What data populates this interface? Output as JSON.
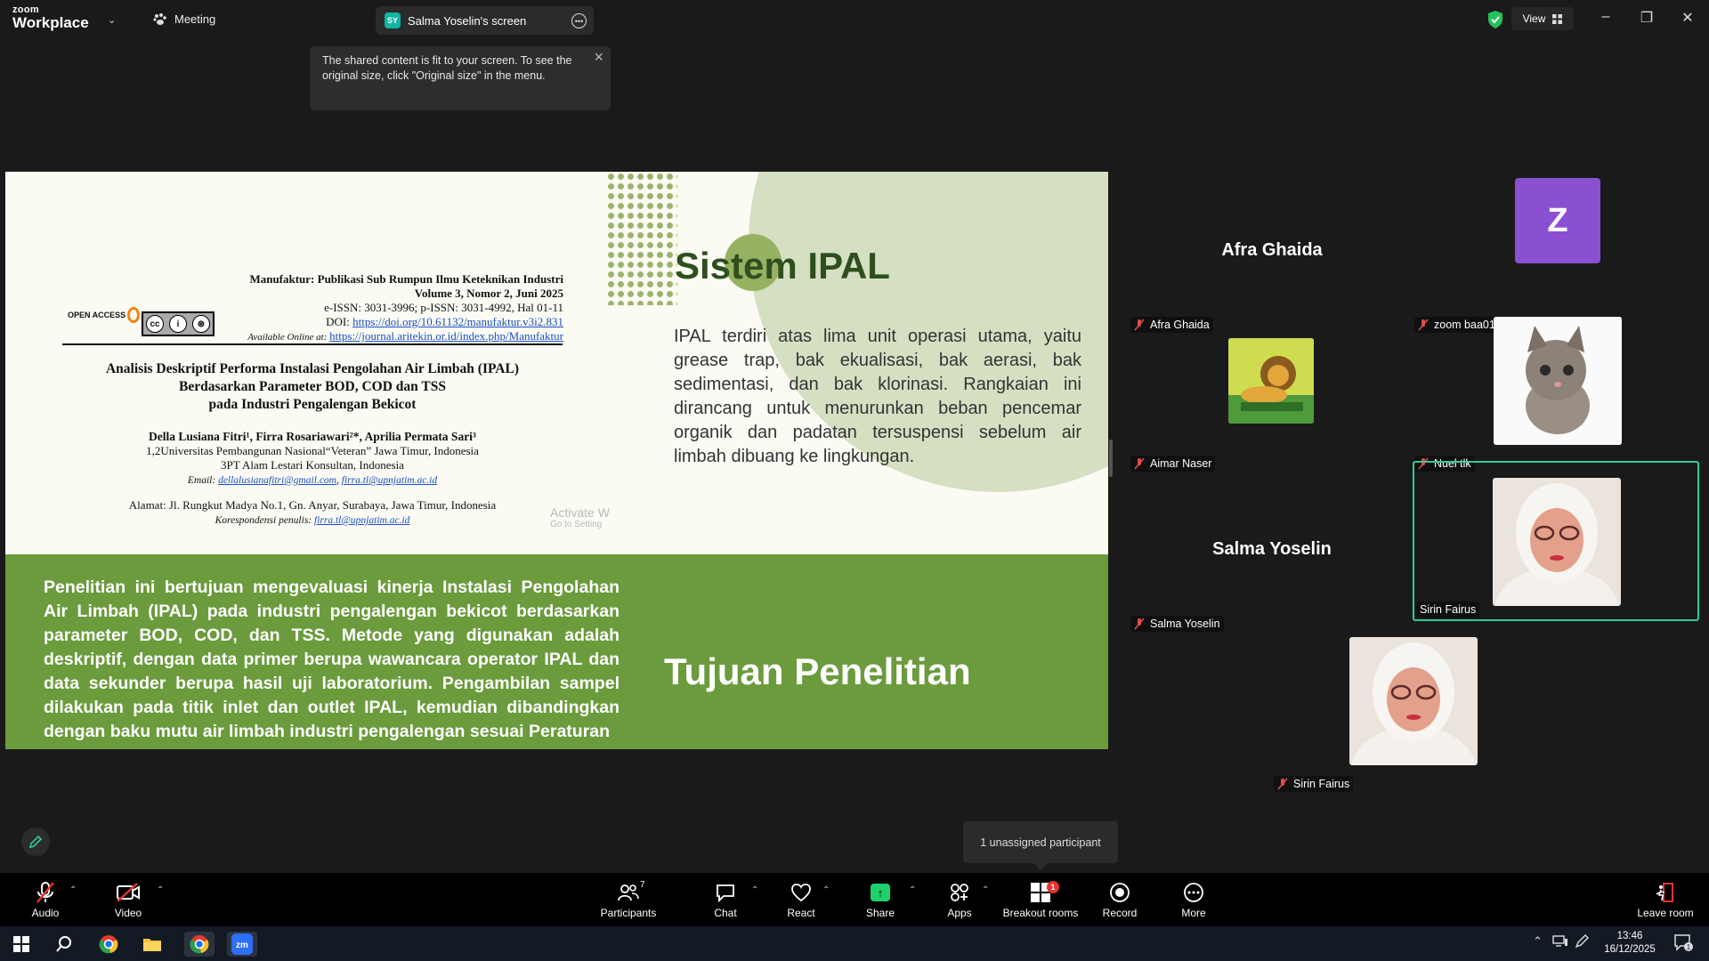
{
  "app": {
    "logo_line1": "zoom",
    "logo_line2": "Workplace",
    "meeting_label": "Meeting",
    "share_tab_badge": "SY",
    "share_tab_title": "Salma Yoselin's screen",
    "view_label": "View"
  },
  "tooltip": {
    "text": "The shared content is fit to your screen. To see the original size, click \"Original size\" in the menu."
  },
  "slide": {
    "ipal_title": "Sistem IPAL",
    "ipal_body": "IPAL terdiri atas lima unit operasi utama, yaitu grease trap, bak ekualisasi, bak aerasi, bak sedimentasi, dan bak klorinasi. Rangkaian ini dirancang untuk menurunkan beban pencemar organik dan padatan tersuspensi sebelum air limbah dibuang ke lingkungan.",
    "paper": {
      "journal": "Manufaktur: Publikasi Sub Rumpun Ilmu Keteknikan Industri",
      "volume": "Volume 3, Nomor 2, Juni 2025",
      "issn": "e-ISSN: 3031-3996; p-ISSN: 3031-4992, Hal 01-11",
      "doi_label": "DOI: ",
      "doi_link": "https://doi.org/10.61132/manufaktur.v3i2.831",
      "available_label": "Available Online at: ",
      "available_link": "https://journal.aritekin.or.id/index.php/Manufaktur",
      "open_access": "OPEN ACCESS",
      "title_line1": "Analisis Deskriptif Performa Instalasi Pengolahan Air Limbah (IPAL)",
      "title_line2": "Berdasarkan Parameter BOD, COD dan TSS",
      "title_line3": "pada Industri Pengalengan Bekicot",
      "authors": "Della Lusiana Fitri¹, Firra Rosariawari²*, Aprilia Permata Sari³",
      "affil1": "1,2Universitas Pembangunan Nasional“Veteran” Jawa Timur, Indonesia",
      "affil2": "3PT Alam Lestari Konsultan, Indonesia",
      "email_label": "Email: ",
      "email1": "dellalusianafitri@gmail.com",
      "email2": "firra.tl@upnjatim.ac.id",
      "address": "Alamat: Jl. Rungkut Madya No.1, Gn. Anyar, Surabaya, Jawa Timur, Indonesia",
      "corr_label": "Korespondensi penulis: ",
      "corr_email": "firra.tl@upnjatim.ac.id"
    },
    "watermark_line1": "Activate W",
    "watermark_line2": "Go to Setting",
    "tujuan_body": "Penelitian ini bertujuan mengevaluasi kinerja Instalasi Pengolahan Air Limbah (IPAL) pada industri pengalengan bekicot berdasarkan parameter BOD, COD, dan TSS. Metode yang digunakan adalah deskriptif, dengan data primer berupa wawancara operator IPAL dan data sekunder berupa hasil uji laboratorium. Pengambilan sampel dilakukan pada titik inlet dan outlet IPAL, kemudian dibandingkan dengan baku mutu air limbah industri pengalengan sesuai Peraturan",
    "tujuan_title": "Tujuan Penelitian"
  },
  "gallery": {
    "afra_name": "Afra Ghaida",
    "afra_label": "Afra Ghaida",
    "zoom_avatar": "Z",
    "zoom_label": "zoom baa01",
    "aimar_label": "Aimar Naser",
    "nuel_label": "Nuel tlk",
    "salma_name": "Salma Yoselin",
    "salma_label": "Salma Yoselin",
    "sirin_label": "Sirin Fairus",
    "sirin2_label": "Sirin Fairus"
  },
  "unassigned": "1 unassigned participant",
  "toolbar": {
    "audio": "Audio",
    "video": "Video",
    "participants": "Participants",
    "participants_count": "7",
    "chat": "Chat",
    "react": "React",
    "share": "Share",
    "apps": "Apps",
    "breakout": "Breakout rooms",
    "breakout_badge": "1",
    "record": "Record",
    "more": "More",
    "leave": "Leave room"
  },
  "taskbar": {
    "time": "13:46",
    "date": "16/12/2025",
    "notif_count": "1"
  },
  "colors": {
    "slide_green": "#6b9b3d",
    "slide_title_green": "#2f4f1e",
    "active_speaker": "#2ecc9a",
    "share_button": "#1ed16b",
    "avatar_purple": "#8b4fd1"
  }
}
